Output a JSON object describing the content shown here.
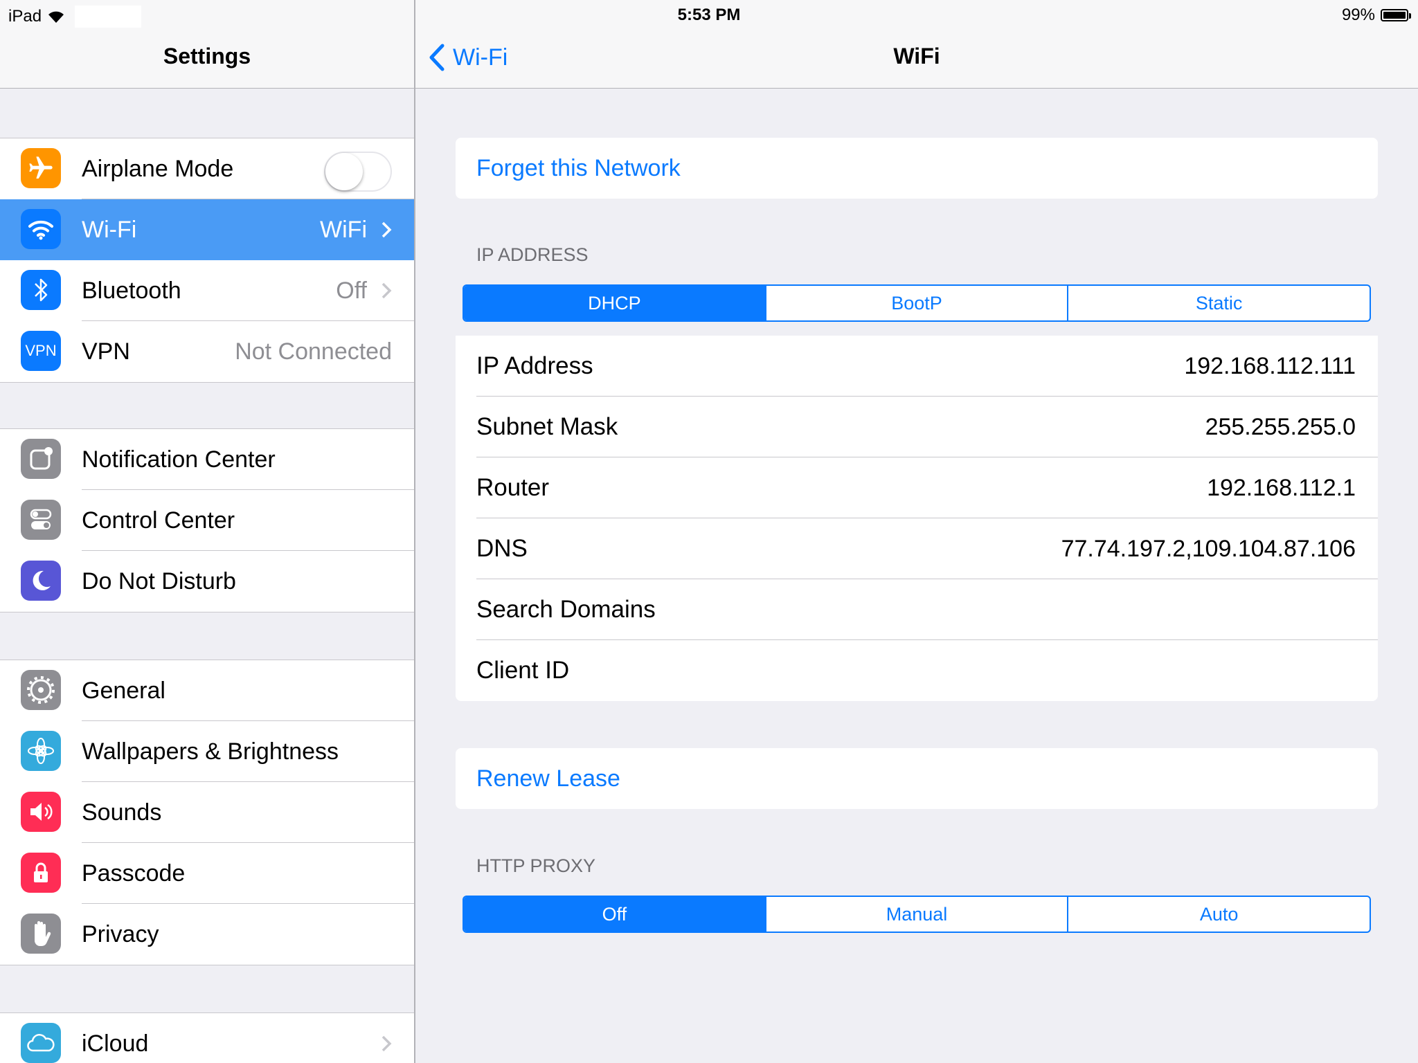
{
  "status_bar": {
    "device": "iPad",
    "time": "5:53 PM",
    "battery": "99%",
    "battery_level": 0.99
  },
  "master": {
    "title": "Settings",
    "groups": [
      {
        "items": [
          {
            "label": "Airplane Mode",
            "icon": "airplane-icon",
            "color": "#ff9500",
            "toggle": false
          },
          {
            "label": "Wi-Fi",
            "icon": "wifi-icon",
            "color": "#0a7aff",
            "detail": "WiFi",
            "selected": true
          },
          {
            "label": "Bluetooth",
            "icon": "bluetooth-icon",
            "color": "#0a7aff",
            "detail": "Off"
          },
          {
            "label": "VPN",
            "icon": "vpn-icon",
            "color": "#0a7aff",
            "detail": "Not Connected",
            "icon_text": "VPN"
          }
        ]
      },
      {
        "items": [
          {
            "label": "Notification Center",
            "icon": "notification-center-icon",
            "color": "#8e8e93"
          },
          {
            "label": "Control Center",
            "icon": "control-center-icon",
            "color": "#8e8e93"
          },
          {
            "label": "Do Not Disturb",
            "icon": "moon-icon",
            "color": "#5856d6"
          }
        ]
      },
      {
        "items": [
          {
            "label": "General",
            "icon": "gear-icon",
            "color": "#8e8e93"
          },
          {
            "label": "Wallpapers & Brightness",
            "icon": "flower-icon",
            "color": "#34aadc"
          },
          {
            "label": "Sounds",
            "icon": "speaker-icon",
            "color": "#ff2d55"
          },
          {
            "label": "Passcode",
            "icon": "lock-icon",
            "color": "#ff2d55"
          },
          {
            "label": "Privacy",
            "icon": "hand-icon",
            "color": "#8e8e93"
          }
        ]
      },
      {
        "items": [
          {
            "label": "iCloud",
            "icon": "cloud-icon",
            "color": "#34aadc"
          }
        ]
      }
    ]
  },
  "detail": {
    "back_label": "Wi-Fi",
    "title": "WiFi",
    "forget": "Forget this Network",
    "ip_header": "IP ADDRESS",
    "ip_modes": [
      "DHCP",
      "BootP",
      "Static"
    ],
    "ip_mode_selected": "DHCP",
    "fields": [
      {
        "key": "IP Address",
        "value": "192.168.112.111"
      },
      {
        "key": "Subnet Mask",
        "value": "255.255.255.0"
      },
      {
        "key": "Router",
        "value": "192.168.112.1"
      },
      {
        "key": "DNS",
        "value": "77.74.197.2,109.104.87.106"
      },
      {
        "key": "Search Domains",
        "value": ""
      },
      {
        "key": "Client ID",
        "value": ""
      }
    ],
    "renew": "Renew Lease",
    "proxy_header": "HTTP PROXY",
    "proxy_modes": [
      "Off",
      "Manual",
      "Auto"
    ],
    "proxy_mode_selected": "Off"
  },
  "colors": {
    "accent": "#0a7aff",
    "selected_row": "#4a9bf5",
    "background": "#efeff4"
  }
}
